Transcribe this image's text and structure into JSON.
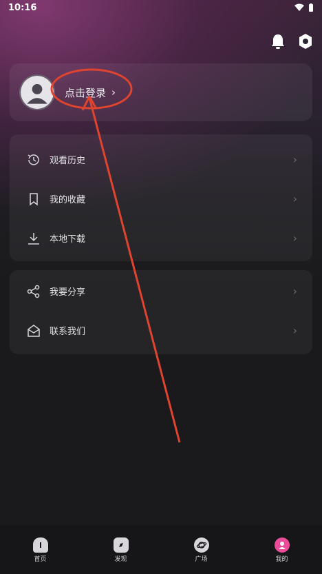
{
  "status_bar": {
    "time": "10:16"
  },
  "login": {
    "label": "点击登录",
    "chevron": "›"
  },
  "menu_group_1": [
    {
      "label": "观看历史",
      "icon": "history-icon"
    },
    {
      "label": "我的收藏",
      "icon": "bookmark-icon"
    },
    {
      "label": "本地下载",
      "icon": "download-icon"
    }
  ],
  "menu_group_2": [
    {
      "label": "我要分享",
      "icon": "share-icon"
    },
    {
      "label": "联系我们",
      "icon": "mail-open-icon"
    }
  ],
  "row_chevron": "›",
  "bottom_nav": [
    {
      "label": "首页",
      "icon": "home-icon"
    },
    {
      "label": "发现",
      "icon": "discover-icon"
    },
    {
      "label": "广场",
      "icon": "planet-icon"
    },
    {
      "label": "我的",
      "icon": "profile-icon",
      "active": true
    }
  ],
  "colors": {
    "accent": "#ec4b9a",
    "annotation": "#e0442f"
  }
}
